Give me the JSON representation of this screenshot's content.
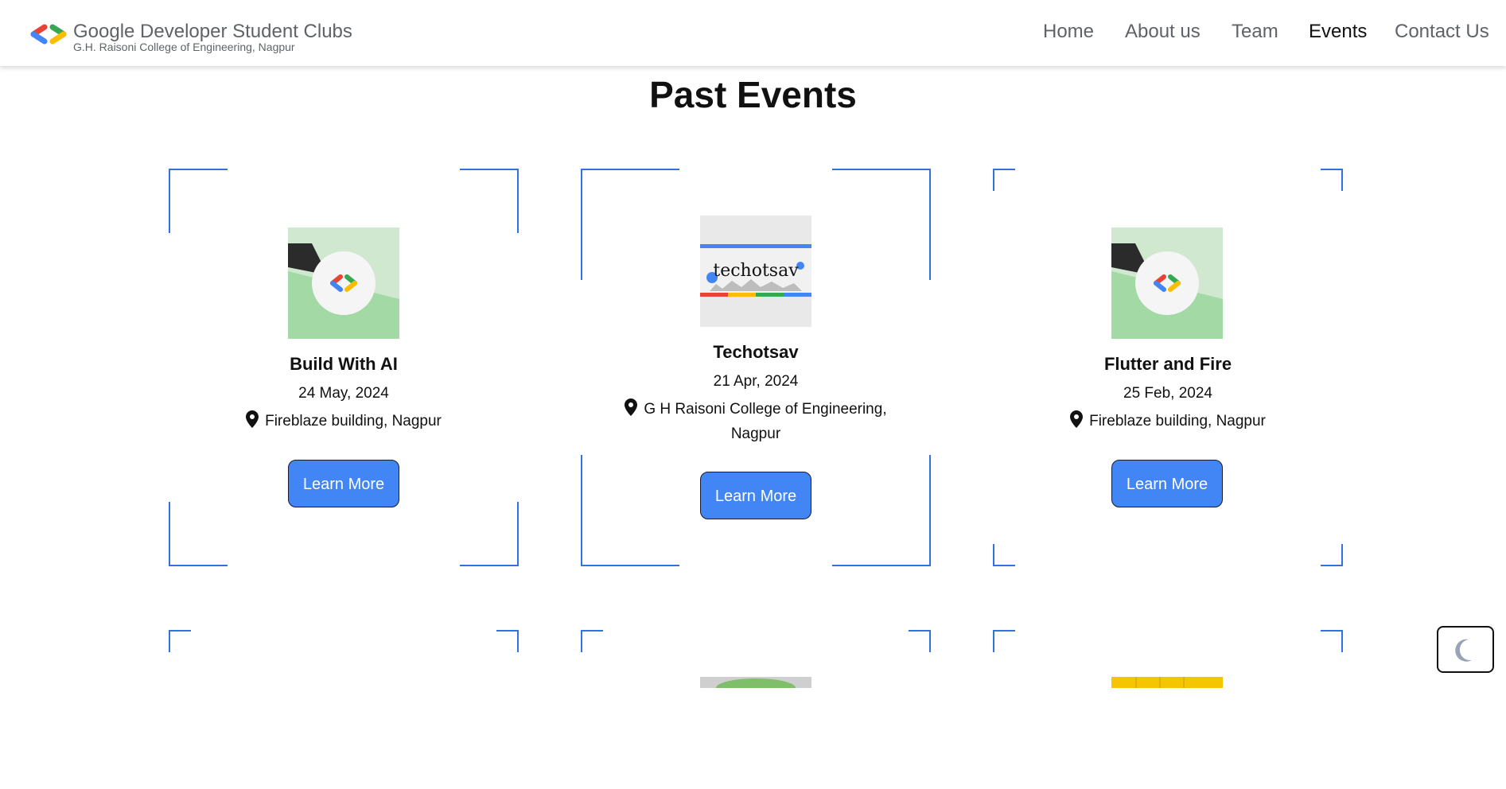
{
  "header": {
    "brand_title": "Google Developer Student Clubs",
    "brand_subtitle": "G.H. Raisoni College of Engineering, Nagpur",
    "nav": [
      "Home",
      "About us",
      "Team",
      "Events",
      "Contact Us"
    ],
    "active_nav": "Events"
  },
  "page": {
    "title": "Past Events"
  },
  "events": [
    {
      "title": "Build With AI",
      "date": "24 May, 2024",
      "location": "Fireblaze building, Nagpur",
      "button": "Learn More",
      "image": "gdsc-logo-banner"
    },
    {
      "title": "Techotsav",
      "date": "21 Apr, 2024",
      "location": "G H Raisoni College of Engineering, Nagpur",
      "button": "Learn More",
      "image": "techotsav-poster",
      "image_text": "techotsav"
    },
    {
      "title": "Flutter and Fire",
      "date": "25 Feb, 2024",
      "location": "Fireblaze building, Nagpur",
      "button": "Learn More",
      "image": "gdsc-logo-banner"
    }
  ],
  "theme_toggle": {
    "icon": "moon-icon"
  },
  "colors": {
    "accent": "#4285f4",
    "frame": "#2f74e0",
    "text": "#111111",
    "muted": "#5f6368"
  }
}
